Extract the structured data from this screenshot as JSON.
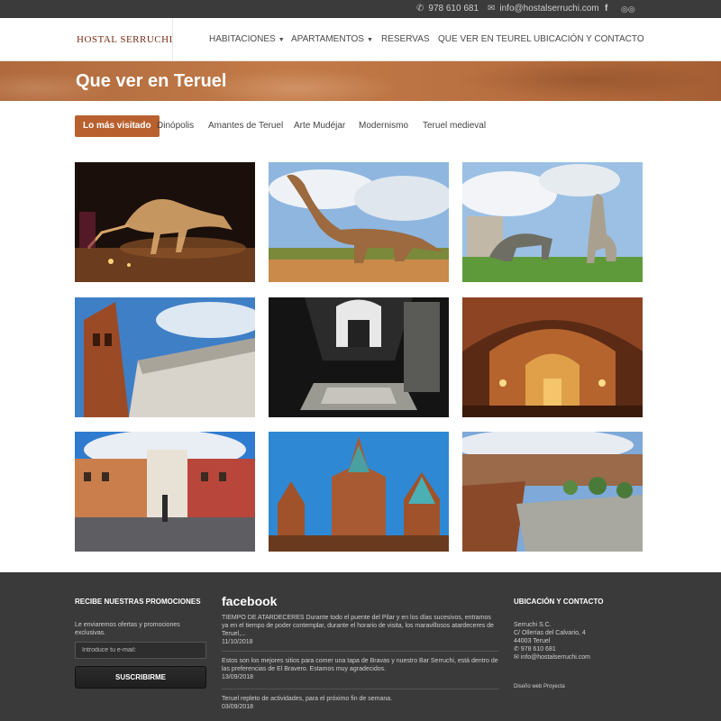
{
  "topbar": {
    "phone": "978 610 681",
    "email": "info@hostalserruchi.com"
  },
  "header": {
    "logo": "HOSTAL SERRUCHI",
    "nav": [
      {
        "label": "HABITACIONES",
        "dropdown": true
      },
      {
        "label": "APARTAMENTOS",
        "dropdown": true
      },
      {
        "label": "RESERVAS",
        "dropdown": false
      },
      {
        "label": "QUE VER EN TEUREL",
        "dropdown": false
      },
      {
        "label": "UBICACIÓN Y CONTACTO",
        "dropdown": false
      }
    ]
  },
  "banner": {
    "title": "Que ver en Teruel"
  },
  "tabs": [
    {
      "label": "Lo más visitado",
      "active": true
    },
    {
      "label": "Dinópolis",
      "active": false
    },
    {
      "label": "Amantes de Teruel",
      "active": false
    },
    {
      "label": "Arte Mudéjar",
      "active": false
    },
    {
      "label": "Modernismo",
      "active": false
    },
    {
      "label": "Teruel medieval",
      "active": false
    }
  ],
  "gallery": [
    {
      "subject": "t-rex-skeleton"
    },
    {
      "subject": "sauropod-statue"
    },
    {
      "subject": "dinopolis-park"
    },
    {
      "subject": "torre-mudejar"
    },
    {
      "subject": "mausoleo-amantes"
    },
    {
      "subject": "church-interior"
    },
    {
      "subject": "plaza-torico"
    },
    {
      "subject": "cathedral-towers"
    },
    {
      "subject": "city-panorama"
    }
  ],
  "footer": {
    "promo": {
      "heading": "RECIBE NUESTRAS PROMOCIONES",
      "text": "Le enviaremos ofertas y promociones exclusivas.",
      "placeholder": "Introduce tu e-mail:",
      "button": "SUSCRIBIRME"
    },
    "facebook": {
      "logo": "facebook",
      "posts": [
        {
          "text": "TIEMPO DE ATARDECERES Durante todo el puente del Pilar y en los días sucesivos, entramos ya en el tiempo de poder contemplar, durante el horario de visita, los maravillosos atardeceres de Teruel,...",
          "date": "11/10/2018"
        },
        {
          "text": "Estos son los mejores sitios para comer una tapa de Bravas y nuestro Bar Serruchi, está dentro de las preferencias de El Bravero. Estamos muy agradecidos.",
          "date": "13/09/2018"
        },
        {
          "text": "Teruel repleto de actividades, para el próximo fin de semana.",
          "date": "03/09/2018"
        }
      ]
    },
    "contact": {
      "heading": "UBICACIÓN Y CONTACTO",
      "company": "Serruchi S.C.",
      "address1": "C/ Ollerías del Calvario, 4",
      "address2": "44003 Teruel",
      "phone": "978 610 681",
      "email": "info@hostalserruchi.com",
      "credit": "Diseño web Proyecta"
    }
  },
  "colors": {
    "accent": "#b8612f",
    "banner": "#c27a48",
    "footer": "#3a3a3a",
    "topbar": "#3b3b3b"
  }
}
